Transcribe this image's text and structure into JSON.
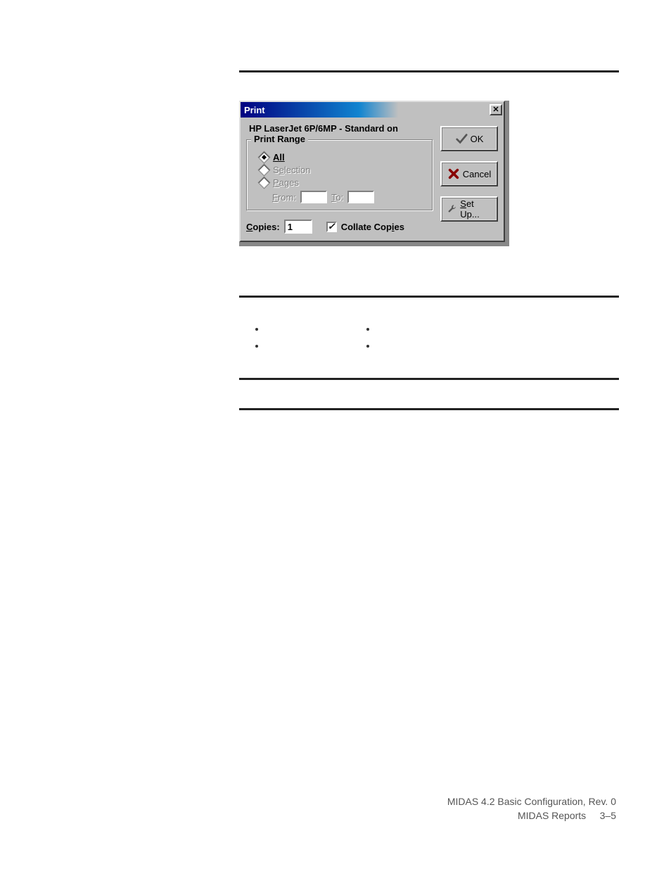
{
  "dialog": {
    "title": "Print",
    "printer": "HP LaserJet 6P/6MP - Standard on",
    "group_title": "Print Range",
    "radios": {
      "all": "All",
      "selection": "Selection",
      "pages": "Pages"
    },
    "from_label": "From:",
    "to_label": "To:",
    "copies_label": "Copies:",
    "copies_value": "1",
    "collate_label": "Collate Copies",
    "buttons": {
      "ok": "OK",
      "cancel": "Cancel",
      "setup": "Set Up..."
    }
  },
  "bullets_col1": [
    "",
    ""
  ],
  "bullets_col2": [
    "",
    ""
  ],
  "footer": {
    "line1": "MIDAS 4.2 Basic Configuration, Rev. 0",
    "line2_left": "MIDAS Reports",
    "line2_right": "3–5"
  }
}
